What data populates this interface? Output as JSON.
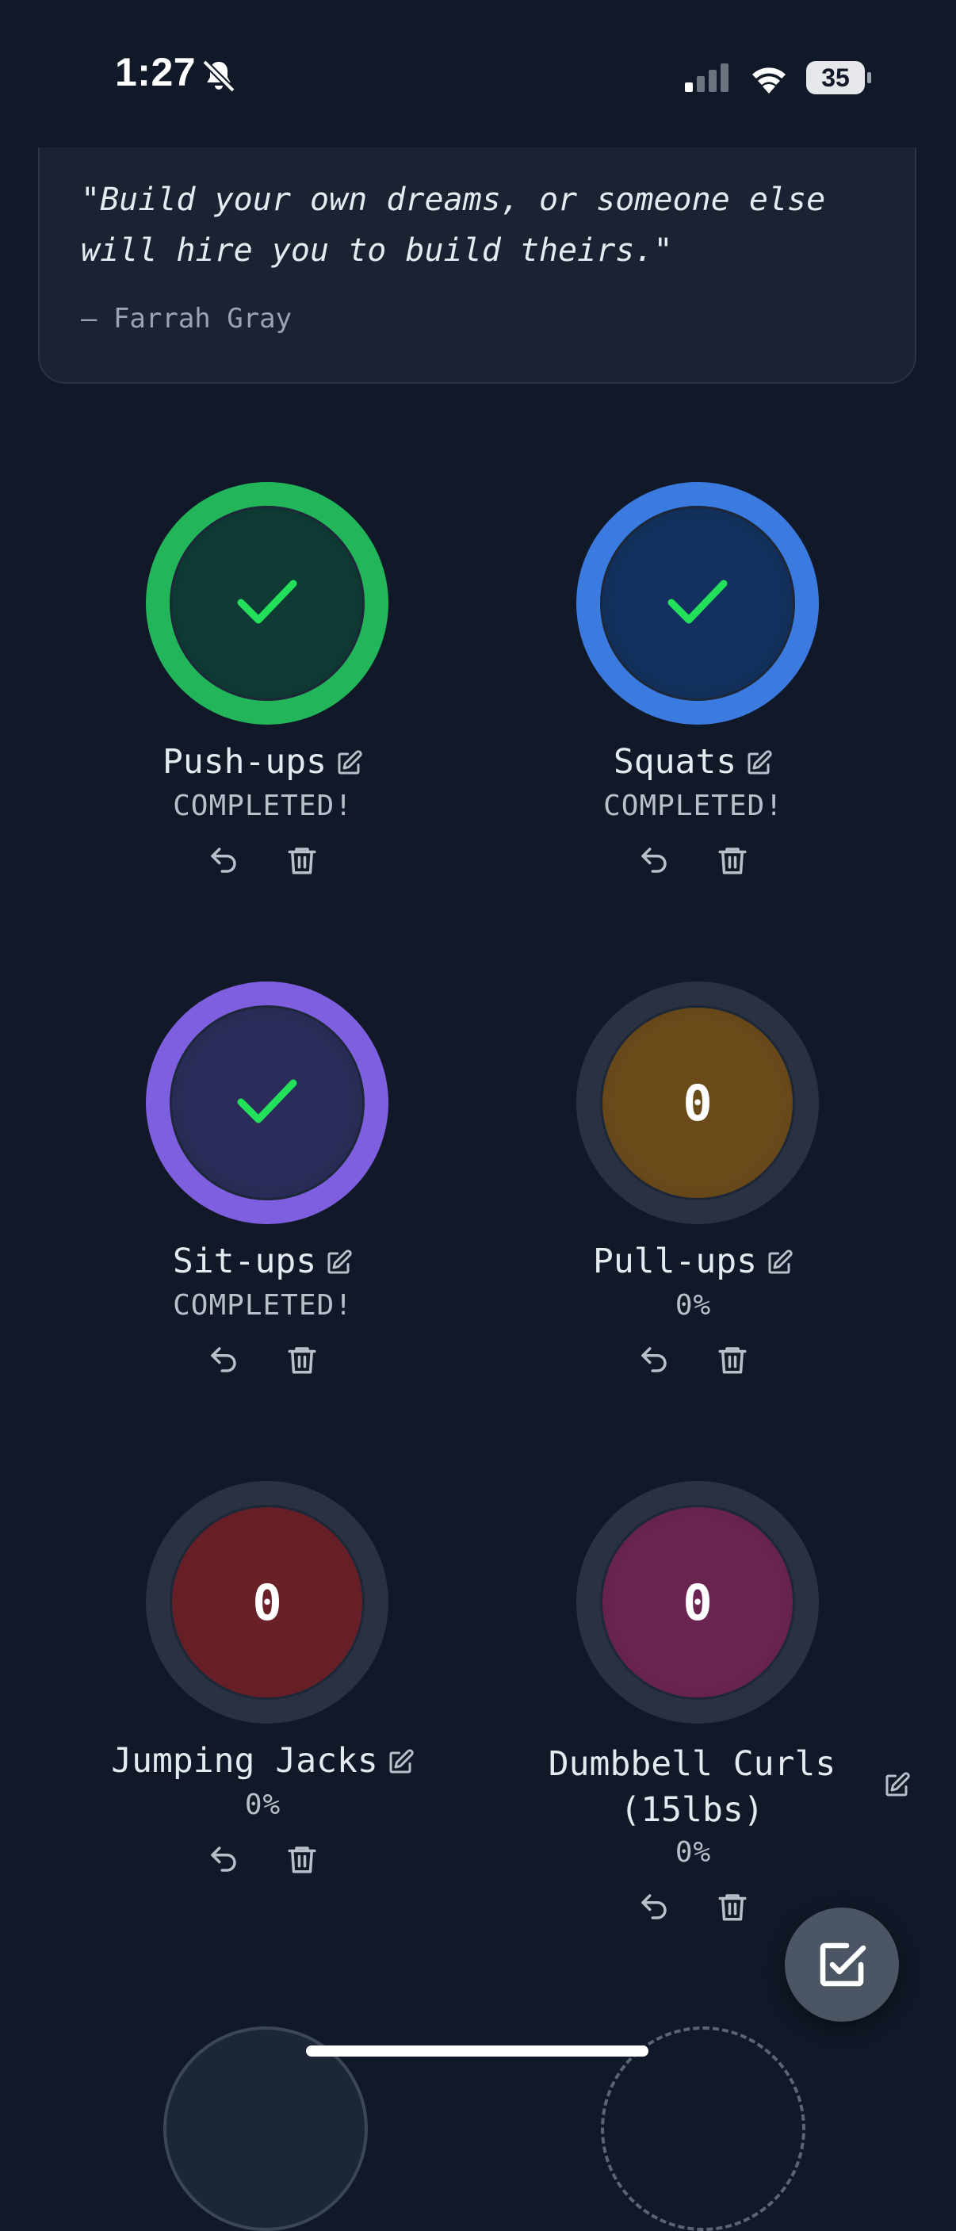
{
  "status_bar": {
    "time": "1:27",
    "battery": "35"
  },
  "quote": {
    "text": "\"Build your own dreams, or someone else will hire you to build theirs.\"",
    "author": "— Farrah Gray"
  },
  "colors": {
    "green": "#22b55a",
    "blue": "#3b7be0",
    "purple": "#7e5fe0",
    "track": "#2a3140",
    "check": "#22e05a"
  },
  "exercises": [
    {
      "name": "Push-ups",
      "status": "COMPLETED!",
      "completed": true,
      "count": "",
      "progress": 1.0,
      "ring": "#22b55a",
      "fill": "#0f3b34"
    },
    {
      "name": "Squats",
      "status": "COMPLETED!",
      "completed": true,
      "count": "",
      "progress": 1.0,
      "ring": "#3b7be0",
      "fill": "#13305e"
    },
    {
      "name": "Sit-ups",
      "status": "COMPLETED!",
      "completed": true,
      "count": "",
      "progress": 1.0,
      "ring": "#7e5fe0",
      "fill": "#2c2c5a"
    },
    {
      "name": "Pull-ups",
      "status": "0%",
      "completed": false,
      "count": "0",
      "progress": 0,
      "ring": "#2a3140",
      "fill": "#6b4a1a"
    },
    {
      "name": "Jumping Jacks",
      "status": "0%",
      "completed": false,
      "count": "0",
      "progress": 0,
      "ring": "#2a3140",
      "fill": "#6a2027"
    },
    {
      "name": "Dumbbell Curls (15lbs)",
      "status": "0%",
      "completed": false,
      "count": "0",
      "progress": 0,
      "ring": "#2a3140",
      "fill": "#6a2450"
    }
  ],
  "icons": {
    "edit": "edit-icon",
    "undo": "undo-icon",
    "delete": "trash-icon",
    "fab": "checkbox-edit-icon"
  }
}
